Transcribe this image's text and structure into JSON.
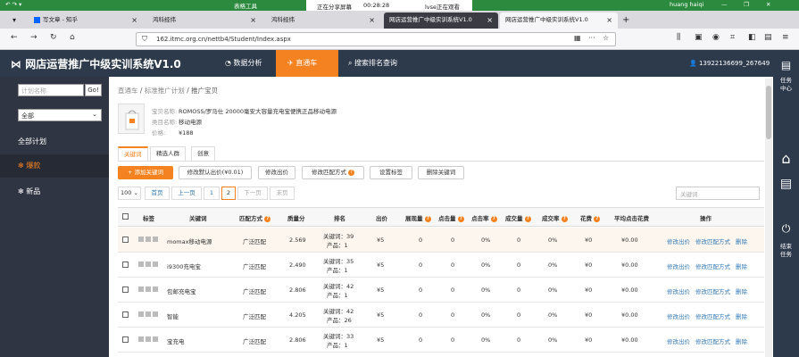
{
  "titlebar": {
    "tools": "表格工具",
    "user": "huang haiqi"
  },
  "share": {
    "status": "正在分享屏幕",
    "time": "00:28:28",
    "viewers": "lvse正在观看"
  },
  "tabs": [
    {
      "label": "写文章 - 知乎"
    },
    {
      "label": "鸿科经纬"
    },
    {
      "label": "鸿科经纬"
    },
    {
      "label": "网店运营推广中级实训系统V1.0"
    },
    {
      "label": "网店运营推广中级实训系统V1.0"
    }
  ],
  "address": {
    "url": "162.itmc.org.cn/nettb4/Student/Index.aspx"
  },
  "header": {
    "brand": "网店运营推广中级实训系统V1.0",
    "nav": [
      {
        "label": "数据分析",
        "icon": "pie-chart-icon"
      },
      {
        "label": "直通车",
        "icon": "paper-plane-icon"
      },
      {
        "label": "搜索排名查询",
        "icon": "search-icon"
      }
    ],
    "user": "13922136699_267649"
  },
  "rail": {
    "task_center": "任务中心",
    "end_task": "结束任务"
  },
  "sidebar": {
    "search_placeholder": "计划名称",
    "go": "Go!",
    "select": "全部",
    "items": [
      {
        "label": "全部计划"
      },
      {
        "label": "爆款"
      },
      {
        "label": "新品"
      }
    ]
  },
  "breadcrumb": {
    "a": "直通车",
    "b": "标准推广计划",
    "c": "推广宝贝",
    "sep": "/"
  },
  "product": {
    "name_label": "宝贝名称:",
    "name": "ROMOSS/罗马仕 20000毫安大容量充电宝便携正品移动电源",
    "cat_label": "类目名称:",
    "cat": "移动电源",
    "price_label": "价格:",
    "price": "¥188"
  },
  "subtabs": [
    {
      "label": "关键词"
    },
    {
      "label": "精选人群"
    },
    {
      "label": "创意"
    }
  ],
  "toolbar": {
    "add": "添加关键词",
    "default_bid": "修改默认出价(¥0.01)",
    "bid": "修改出价",
    "match": "修改匹配方式",
    "tags": "设置标签",
    "delete": "删除关键词"
  },
  "pager": {
    "size": "100",
    "first": "首页",
    "prev": "上一页",
    "p1": "1",
    "p2": "2",
    "next": "下一页",
    "last": "末页"
  },
  "kw_placeholder": "关键词",
  "table": {
    "headers": {
      "tag": "标签",
      "keyword": "关键词",
      "match": "匹配方式",
      "quality": "质量分",
      "rank": "排名",
      "bid": "出价",
      "impr": "展现量",
      "clicks": "点击量",
      "ctr": "点击率",
      "deals": "成交量",
      "cvr": "成交率",
      "cost": "花费",
      "cpc": "平均点击花费",
      "ops": "操作"
    },
    "rows": [
      {
        "keyword": "momax移动电源",
        "match": "广泛匹配",
        "quality": "2.569",
        "rank1": "关键词：39",
        "rank2": "产品：1",
        "bid": "¥5",
        "impr": "0",
        "clicks": "0",
        "ctr": "0%",
        "deals": "0",
        "cvr": "0%",
        "cost": "¥0",
        "cpc": "¥0.00"
      },
      {
        "keyword": "i9300充电宝",
        "match": "广泛匹配",
        "quality": "2.490",
        "rank1": "关键词：35",
        "rank2": "产品：1",
        "bid": "¥5",
        "impr": "0",
        "clicks": "0",
        "ctr": "0%",
        "deals": "0",
        "cvr": "0%",
        "cost": "¥0",
        "cpc": "¥0.00"
      },
      {
        "keyword": "包邮充电宝",
        "match": "广泛匹配",
        "quality": "2.806",
        "rank1": "关键词：42",
        "rank2": "产品：1",
        "bid": "¥5",
        "impr": "0",
        "clicks": "0",
        "ctr": "0%",
        "deals": "0",
        "cvr": "0%",
        "cost": "¥0",
        "cpc": "¥0.00"
      },
      {
        "keyword": "智能",
        "match": "广泛匹配",
        "quality": "4.205",
        "rank1": "关键词：42",
        "rank2": "产品：26",
        "bid": "¥5",
        "impr": "0",
        "clicks": "0",
        "ctr": "0%",
        "deals": "0",
        "cvr": "0%",
        "cost": "¥0",
        "cpc": "¥0.00"
      },
      {
        "keyword": "宝充电",
        "match": "广泛匹配",
        "quality": "2.806",
        "rank1": "关键词：33",
        "rank2": "产品：1",
        "bid": "¥5",
        "impr": "0",
        "clicks": "0",
        "ctr": "0%",
        "deals": "0",
        "cvr": "0%",
        "cost": "¥0",
        "cpc": "¥0.00"
      }
    ],
    "ops": {
      "bid": "修改出价",
      "match": "修改匹配方式",
      "del": "删除"
    }
  },
  "colors": {
    "accent": "#f58220",
    "header": "#2d3a4b",
    "sidebar": "#303543",
    "link": "#337ab7"
  }
}
